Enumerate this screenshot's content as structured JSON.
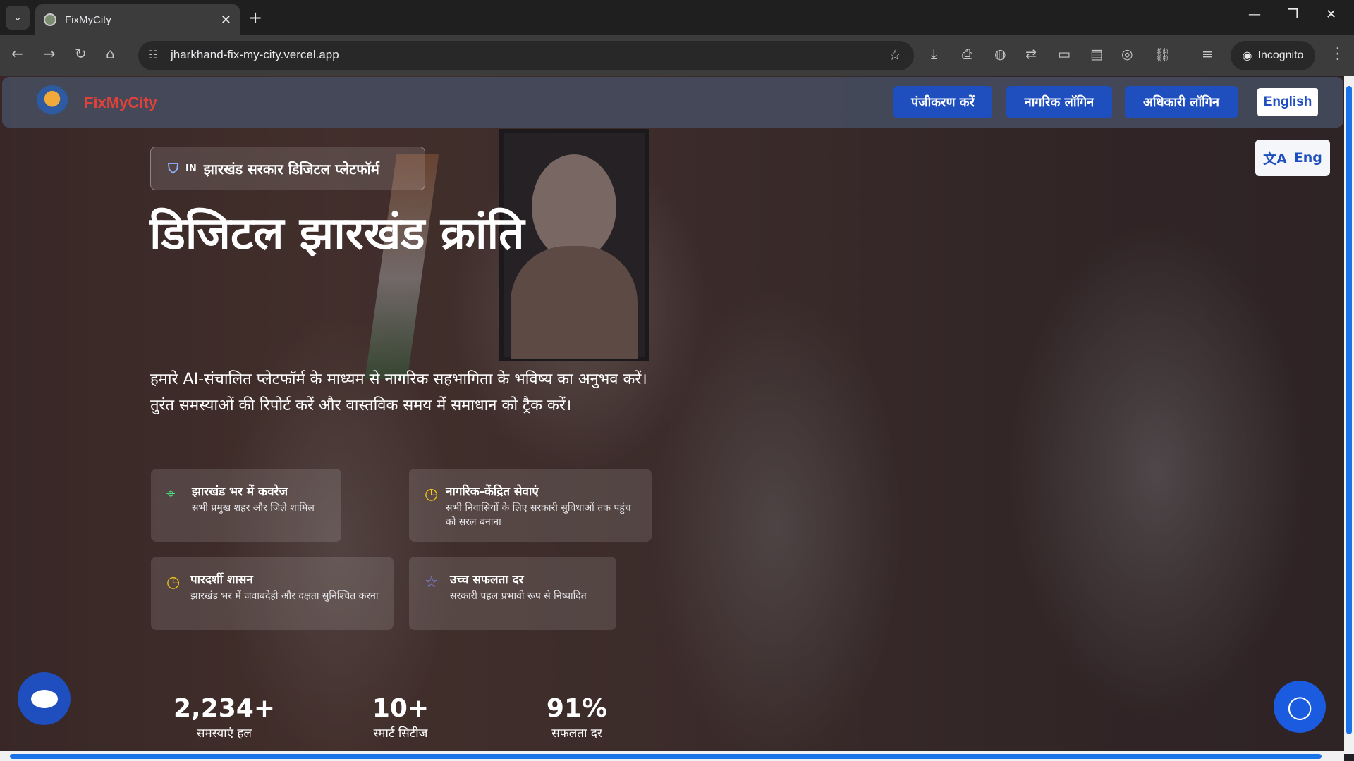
{
  "browser": {
    "tab_title": "FixMyCity",
    "url": "jharkhand-fix-my-city.vercel.app",
    "incognito_label": "Incognito"
  },
  "header": {
    "logo_text": "FixMyCity",
    "register_label": "पंजीकरण करें",
    "citizen_login_label": "नागरिक लॉगिन",
    "officer_login_label": "अधिकारी लॉगिन",
    "language_label": "English"
  },
  "hero": {
    "badge_flag": "IN",
    "badge_text": "झारखंड सरकार डिजिटल प्लेटफॉर्म",
    "headline": "डिजिटल झारखंड क्रांति",
    "description": "हमारे AI-संचालित प्लेटफॉर्म के माध्यम से नागरिक सहभागिता के भविष्य का अनुभव करें। तुरंत समस्याओं की रिपोर्ट करें और वास्तविक समय में समाधान को ट्रैक करें।",
    "translate_label": "Eng"
  },
  "features": [
    {
      "title": "झारखंड भर में कवरेज",
      "desc": "सभी प्रमुख शहर और जिले शामिल",
      "icon": "location-pin-icon",
      "color": "#4ade80"
    },
    {
      "title": "नागरिक-केंद्रित सेवाएं",
      "desc": "सभी निवासियों के लिए सरकारी सुविधाओं तक पहुंच को सरल बनाना",
      "icon": "clock-icon",
      "color": "#facc15"
    },
    {
      "title": "पारदर्शी शासन",
      "desc": "झारखंड भर में जवाबदेही और दक्षता सुनिश्चित करना",
      "icon": "clock-icon",
      "color": "#facc15"
    },
    {
      "title": "उच्च सफलता दर",
      "desc": "सरकारी पहल प्रभावी रूप से निष्पादित",
      "icon": "star-icon",
      "color": "#818cf8"
    }
  ],
  "stats": [
    {
      "value": "2,234+",
      "label": "समस्याएं हल"
    },
    {
      "value": "10+",
      "label": "स्मार्ट सिटीज"
    },
    {
      "value": "91%",
      "label": "सफलता दर"
    }
  ]
}
